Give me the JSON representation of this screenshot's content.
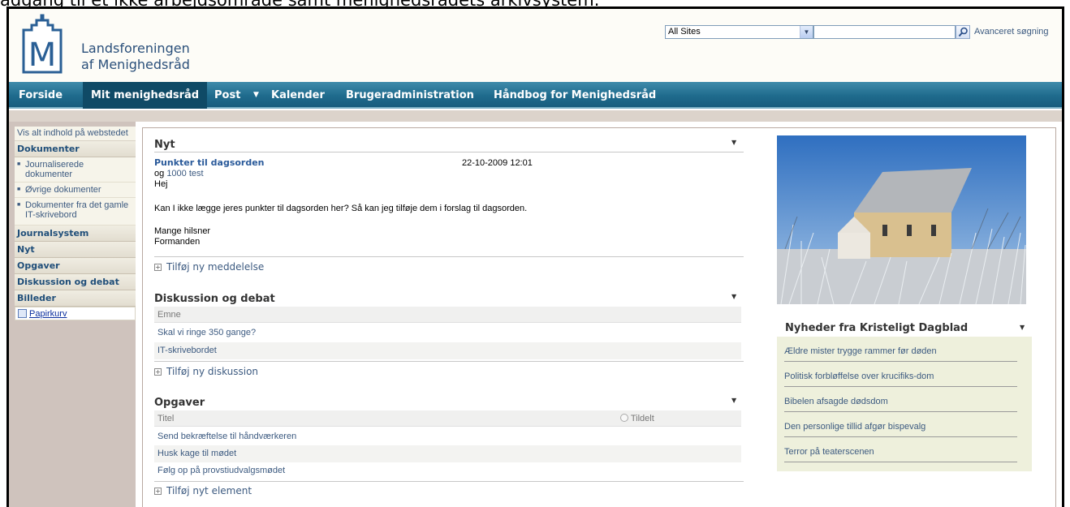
{
  "caption": "adgang til et ikke arbejdsområde samt menighedsrådets arkivsystem.",
  "header": {
    "org_line1": "Landsforeningen",
    "org_line2": "af Menighedsråd",
    "search_scope": "All Sites",
    "search_value": "",
    "advanced_search": "Avanceret søgning"
  },
  "topnav": {
    "items": [
      "Forside",
      "Mit menighedsråd",
      "Post",
      "Kalender",
      "Brugeradministration",
      "Håndbog for Menighedsråd"
    ],
    "active": "Mit menighedsråd"
  },
  "leftnav": {
    "view_all": "Vis alt indhold på webstedet",
    "dokumenter": "Dokumenter",
    "dokumenter_items": [
      "Journaliserede dokumenter",
      "Øvrige dokumenter",
      "Dokumenter fra det gamle IT-skrivebord"
    ],
    "sections": [
      "Journalsystem",
      "Nyt",
      "Opgaver",
      "Diskussion og debat",
      "Billeder"
    ],
    "recycle": "Papirkurv"
  },
  "nyt": {
    "title": "Nyt",
    "post_title": "Punkter til dagsorden",
    "post_date": "22-10-2009 12:01",
    "post_og": "og",
    "post_og_link": "1000 test",
    "body_hej": "Hej",
    "body_text": "Kan I ikke lægge jeres punkter til dagsorden her? Så kan jeg tilføje dem i forslag til dagsorden.",
    "body_greeting": "Mange hilsner",
    "body_sign": "Formanden",
    "add_link": "Tilføj ny meddelelse"
  },
  "diskussion": {
    "title": "Diskussion og debat",
    "column": "Emne",
    "rows": [
      "Skal vi ringe 350 gange?",
      "IT-skrivebordet"
    ],
    "add_link": "Tilføj ny diskussion"
  },
  "opgaver": {
    "title": "Opgaver",
    "column_title": "Titel",
    "column_assigned": "Tildelt",
    "rows": [
      "Send bekræftelse til håndværkeren",
      "Husk kage til mødet",
      "Følg op på provstiudvalgsmødet"
    ],
    "add_link": "Tilføj nyt element"
  },
  "news": {
    "title": "Nyheder fra Kristeligt Dagblad",
    "items": [
      "Ældre mister trygge rammer før døden",
      "Politisk forbløffelse over krucifiks-dom",
      "Bibelen afsagde dødsdom",
      "Den personlige tillid afgør bispevalg",
      "Terror på teaterscenen"
    ]
  },
  "colors": {
    "nav_blue": "#1f6b8d",
    "link_blue": "#3c5a80",
    "leftnav_bg": "#cfc3bd",
    "news_bg": "#eef0dc"
  }
}
